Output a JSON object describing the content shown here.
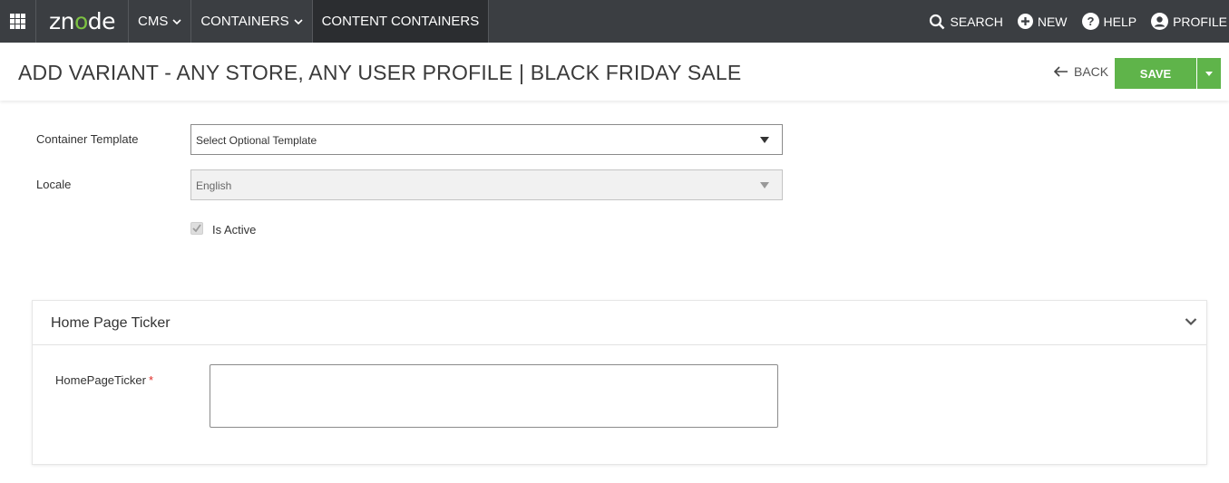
{
  "nav": {
    "logo": "znode",
    "items": [
      {
        "label": "CMS"
      },
      {
        "label": "CONTAINERS"
      },
      {
        "label": "CONTENT CONTAINERS"
      }
    ],
    "right": [
      {
        "label": "SEARCH",
        "icon": "search-icon"
      },
      {
        "label": "NEW",
        "icon": "plus-circle-icon"
      },
      {
        "label": "HELP",
        "icon": "help-icon"
      },
      {
        "label": "PROFILE",
        "icon": "user-icon"
      }
    ]
  },
  "header": {
    "title": "ADD VARIANT - ANY STORE, ANY USER PROFILE | BLACK FRIDAY SALE",
    "back_label": "BACK",
    "save_label": "SAVE"
  },
  "form": {
    "template_label": "Container Template",
    "template_value": "Select Optional Template",
    "locale_label": "Locale",
    "locale_value": "English",
    "active_label": "Is Active",
    "active_checked": true
  },
  "panel": {
    "title": "Home Page Ticker",
    "field_label": "HomePageTicker",
    "field_required": "*",
    "field_value": ""
  },
  "colors": {
    "nav_bg": "#3b3e42",
    "accent": "#5fb44a",
    "required": "#e02b27"
  }
}
